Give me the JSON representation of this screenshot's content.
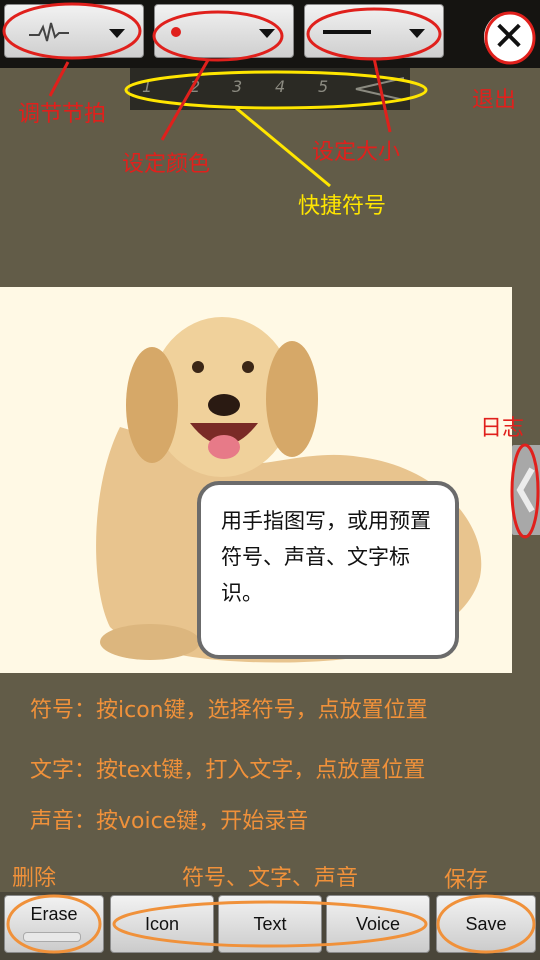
{
  "toolbar": {
    "tempo_icon": "heartbeat-icon",
    "color_dot": "#e0201c",
    "close_label": "✕"
  },
  "quick_symbols": [
    "1",
    "2",
    "3",
    "4",
    "5"
  ],
  "annotations": {
    "tempo": "调节节拍",
    "color": "设定颜色",
    "size": "设定大小",
    "quick": "快捷符号",
    "exit": "退出",
    "log": "日志",
    "erase": "删除",
    "icon_text_voice": "符号、文字、声音",
    "save": "保存"
  },
  "bubble": {
    "text": "用手指图写，或用预置符号、声音、文字标识。"
  },
  "instructions": [
    "符号：按icon键，选择符号，点放置位置",
    "文字：按text键，打入文字，点放置位置",
    "声音：按voice键，开始录音"
  ],
  "bottom": {
    "erase": "Erase",
    "icon": "Icon",
    "text": "Text",
    "voice": "Voice",
    "save": "Save"
  },
  "colors": {
    "annotation_red": "#e0201c",
    "annotation_yellow": "#ffe600",
    "annotation_orange": "#f0913a",
    "background": "#625c48"
  }
}
